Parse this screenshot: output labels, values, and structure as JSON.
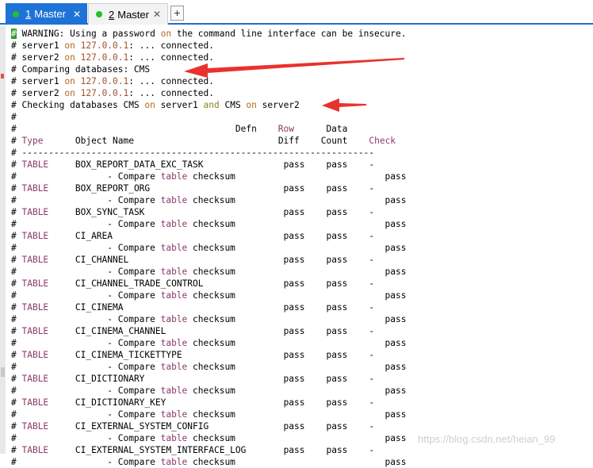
{
  "tabs": [
    {
      "number": "1",
      "label": "Master",
      "close": "✕"
    },
    {
      "number": "2",
      "label": "Master",
      "close": "✕"
    }
  ],
  "new_tab_label": "+",
  "terminal": {
    "header": {
      "warning_prefix": "WARNING: Using a password ",
      "warning_on": "on",
      "warning_mid": " the command line interface can be insecure.",
      "server1": "server1",
      "server2": "server2",
      "host": "127.0.0.1",
      "connected": ": ... connected.",
      "on_kw": "on",
      "comparing": "Comparing databases: CMS",
      "checking_a": "Checking databases CMS ",
      "checking_b": " server1 ",
      "and_kw": "and",
      "checking_c": " CMS ",
      "checking_d": " server2"
    },
    "columns": {
      "defn": "Defn",
      "diff": "Diff",
      "row": "Row",
      "count": "Count",
      "data": "Data",
      "check": "Check",
      "type": "Type",
      "object_name": "Object Name",
      "separator": "------------------------------------------------------------------"
    },
    "row_type": "TABLE",
    "compare_prefix": "- Compare ",
    "compare_table_kw": "table",
    "compare_suffix": " checksum",
    "pass": "pass",
    "dash": "-",
    "rows": [
      {
        "name": "BOX_REPORT_DATA_EXC_TASK"
      },
      {
        "name": "BOX_REPORT_ORG"
      },
      {
        "name": "BOX_SYNC_TASK"
      },
      {
        "name": "CI_AREA"
      },
      {
        "name": "CI_CHANNEL"
      },
      {
        "name": "CI_CHANNEL_TRADE_CONTROL"
      },
      {
        "name": "CI_CINEMA"
      },
      {
        "name": "CI_CINEMA_CHANNEL"
      },
      {
        "name": "CI_CINEMA_TICKETTYPE"
      },
      {
        "name": "CI_DICTIONARY"
      },
      {
        "name": "CI_DICTIONARY_KEY"
      },
      {
        "name": "CI_EXTERNAL_SYSTEM_CONFIG"
      },
      {
        "name": "CI_EXTERNAL_SYSTEM_INTERFACE_LOG"
      }
    ]
  },
  "watermark": "https://blog.csdn.net/heian_99",
  "colors": {
    "active_tab": "#1e73d6",
    "status_dot": "#22c02a",
    "arrow": "#e8322e",
    "keyword": "#b06a1e"
  }
}
